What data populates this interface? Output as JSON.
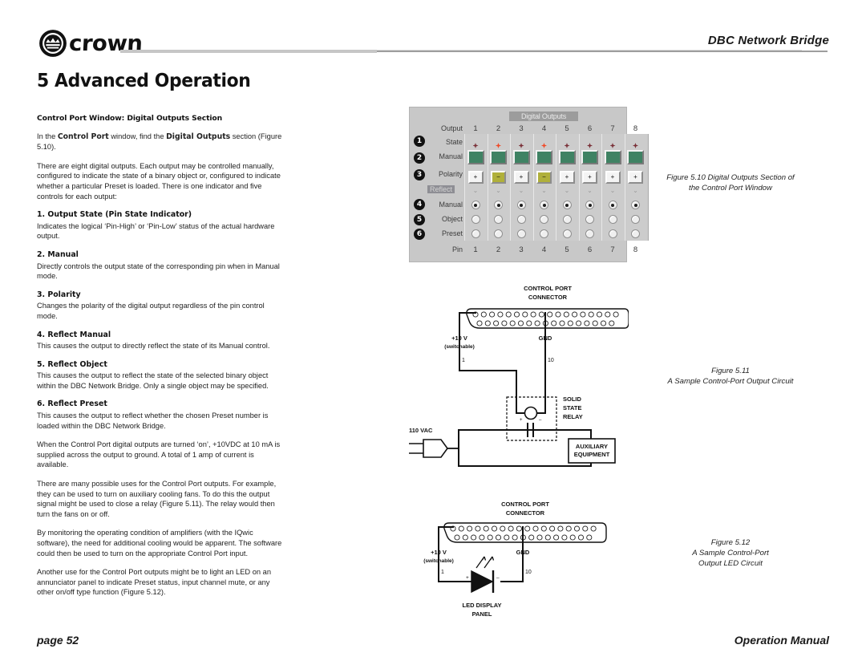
{
  "header": {
    "brand": "crown",
    "document_title": "DBC Network Bridge"
  },
  "chapter": {
    "title": "5 Advanced Operation"
  },
  "body": {
    "section_heading": "Control Port Window: Digital Outputs Section",
    "intro_p1_a": "In the ",
    "intro_p1_b": "Control Port",
    "intro_p1_c": " window, find the ",
    "intro_p1_d": "Digital Outputs",
    "intro_p1_e": " section (Figure 5.10).",
    "intro_p2": "There are eight digital outputs. Each output may be controlled manually, configured to indicate the state of a binary object or, configured to indicate whether a particular Preset is loaded. There is one indicator and five controls for each output:",
    "items": [
      {
        "number": "1. Output State (Pin State Indicator)",
        "text": "Indicates the logical ‘Pin-High’ or ‘Pin-Low’ status of the actual hardware output."
      },
      {
        "number": "2. Manual",
        "text": "Directly controls the output state of the corresponding pin when in Manual mode."
      },
      {
        "number": "3. Polarity",
        "text": "Changes the polarity of the digital output regardless of the pin control mode."
      },
      {
        "number": "4. Reflect Manual",
        "text": "This causes the output to directly reflect the state of its Manual control."
      },
      {
        "number": "5. Reflect Object",
        "text": "This causes the output to reflect the state of the selected binary object within the DBC Network Bridge. Only a single object may be specified."
      },
      {
        "number": "6. Reflect Preset",
        "text": "This causes the output to reflect whether the chosen Preset number is loaded within the DBC Network Bridge."
      }
    ],
    "para_power": "When the Control Port digital outputs are turned ‘on’, +10VDC at 10 mA is supplied across the output to ground. A total of 1 amp of current is available.",
    "para_uses": "There are many possible uses for the Control Port outputs. For example, they can be used to turn on auxiliary cooling fans. To do this the output signal might be used to close a relay (Figure 5.11). The relay would then turn the fans on or off.",
    "para_monitor": "By monitoring the operating condition of amplifiers (with the IQwic software), the need for additional cooling would be apparent. The software could then be used to turn on the appropriate Control Port input.",
    "para_led": "Another use for the Control Port outputs might be to light an LED on an annunciator panel to indicate Preset status, input channel mute, or any other on/off type function (Figure 5.12)."
  },
  "figure_510": {
    "caption_line1": "Figure 5.10 Digital Outputs Section of",
    "caption_line2": "the Control Port Window",
    "window_title": "Digital Outputs",
    "row_labels": {
      "output": "Output",
      "state": "State",
      "manual": "Manual",
      "polarity": "Polarity",
      "reflect": "Reflect",
      "reflect_manual": "Manual",
      "reflect_object": "Object",
      "reflect_preset": "Preset",
      "pin": "Pin"
    },
    "badges": [
      "1",
      "2",
      "3",
      "4",
      "5",
      "6"
    ],
    "columns": [
      "1",
      "2",
      "3",
      "4",
      "5",
      "6",
      "7",
      "8"
    ],
    "pins": [
      "1",
      "2",
      "3",
      "4",
      "5",
      "6",
      "7",
      "8"
    ],
    "state_on": [
      false,
      true,
      false,
      true,
      false,
      false,
      false,
      false
    ],
    "manual_buttons": [
      "",
      "",
      "",
      "",
      "",
      "",
      "",
      ""
    ],
    "polarity_labels": [
      "+",
      "−",
      "+",
      "−",
      "+",
      "+",
      "+",
      "+"
    ],
    "polarity_negative": [
      false,
      true,
      false,
      true,
      false,
      false,
      false,
      false
    ],
    "reflect_manual_selected": [
      true,
      true,
      true,
      true,
      true,
      true,
      true,
      true
    ],
    "reflect_object_selected": [
      false,
      false,
      false,
      false,
      false,
      false,
      false,
      false
    ],
    "reflect_preset_selected": [
      false,
      false,
      false,
      false,
      false,
      false,
      false,
      false
    ],
    "colors": {
      "window_bg": "#c8c8c8",
      "titlebar": "#9c9c9c",
      "manual_green": "#3f8263",
      "polarity_yellow": "#b0b03b",
      "state_on": "#f04a28",
      "state_off": "#7a3038"
    }
  },
  "figure_511": {
    "caption_line1": "Figure 5.11",
    "caption_line2": "A Sample Control-Port Output Circuit",
    "labels": {
      "connector_line1": "CONTROL PORT",
      "connector_line2": "CONNECTOR",
      "voltage_line1": "+10 V",
      "voltage_line2": "(switchable)",
      "gnd": "GND",
      "pin_left": "1",
      "pin_right": "10",
      "relay_line1": "SOLID",
      "relay_line2": "STATE",
      "relay_line3": "RELAY",
      "mains": "110 VAC",
      "aux_line1": "AUXILIARY",
      "aux_line2": "EQUIPMENT",
      "plus": "+",
      "minus": "–"
    }
  },
  "figure_512": {
    "caption_line1": "Figure 5.12",
    "caption_line2": "A Sample Control-Port",
    "caption_line3": "Output LED Circuit",
    "labels": {
      "connector_line1": "CONTROL PORT",
      "connector_line2": "CONNECTOR",
      "voltage_line1": "+10 V",
      "voltage_line2": "(switchable)",
      "gnd": "GND",
      "pin_left": "1",
      "pin_right": "10",
      "panel_line1": "LED DISPLAY",
      "panel_line2": "PANEL",
      "plus": "+",
      "minus": "–"
    }
  },
  "footer": {
    "page": "page 52",
    "manual": "Operation Manual"
  }
}
